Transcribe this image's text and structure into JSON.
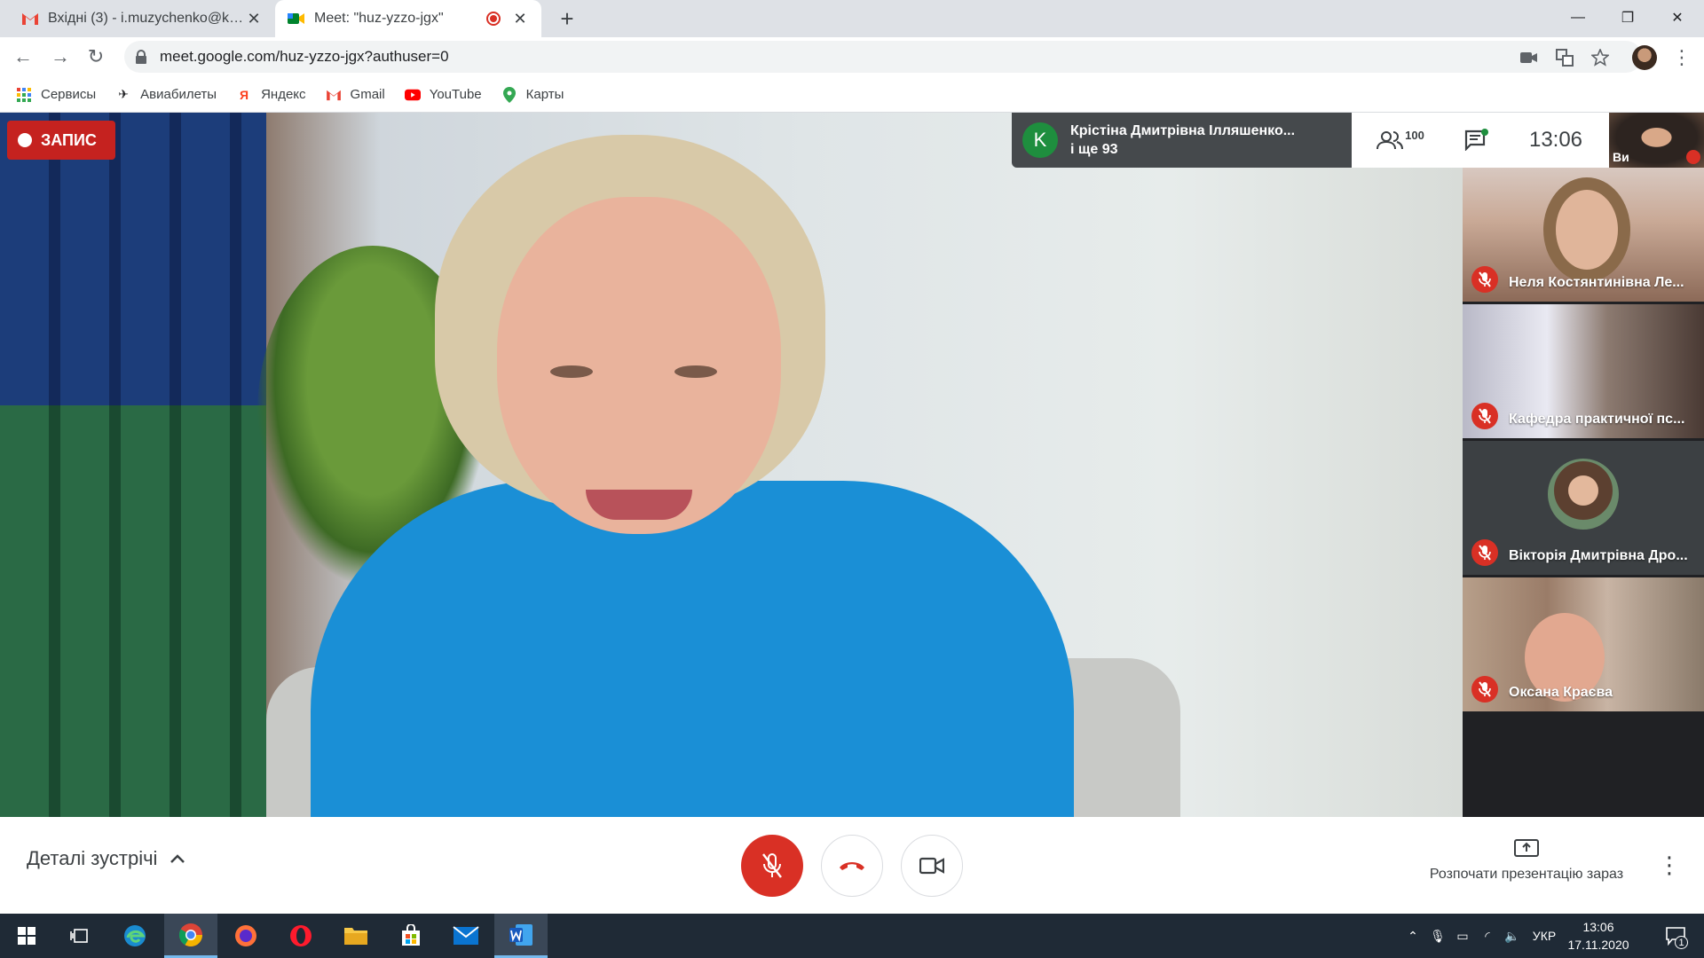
{
  "browser": {
    "tabs": [
      {
        "title": "Вхідні (3) - i.muzychenko@kubg",
        "icon": "gmail-icon"
      },
      {
        "title": "Meet: \"huz-yzzo-jgx\"",
        "icon": "meet-icon"
      }
    ],
    "url": "meet.google.com/huz-yzzo-jgx?authuser=0",
    "bookmarks": [
      {
        "label": "Сервисы",
        "icon": "apps-grid-icon"
      },
      {
        "label": "Авиабилеты",
        "icon": "airplane-icon"
      },
      {
        "label": "Яндекс",
        "icon": "yandex-icon"
      },
      {
        "label": "Gmail",
        "icon": "gmail-icon"
      },
      {
        "label": "YouTube",
        "icon": "youtube-icon"
      },
      {
        "label": "Карты",
        "icon": "maps-pin-icon"
      }
    ]
  },
  "meet": {
    "recording_label": "ЗАПИС",
    "presenter": {
      "initial": "K",
      "name": "Крістіна Дмитрівна Ілляшенко...",
      "others": "і ще 93"
    },
    "participants_count": "100",
    "time": "13:06",
    "self_label": "Ви",
    "participants": [
      {
        "name": "Неля Костянтинівна Ле..."
      },
      {
        "name": "Кафедра практичної пс..."
      },
      {
        "name": "Вікторія Дмитрівна Дро..."
      },
      {
        "name": "Оксана Краєва"
      }
    ],
    "details_label": "Деталі зустрічі",
    "present_label": "Розпочати презентацію зараз",
    "colors": {
      "mic_off": "#d93025",
      "end_call": "#d93025",
      "presenter_avatar": "#1e8e3e"
    }
  },
  "taskbar": {
    "apps": [
      "windows-start-icon",
      "task-view-icon",
      "edge-icon",
      "chrome-icon",
      "firefox-icon",
      "opera-icon",
      "file-explorer-icon",
      "store-icon",
      "mail-icon",
      "word-icon"
    ],
    "language": "УКР",
    "time": "13:06",
    "date": "17.11.2020",
    "notifications": "1"
  }
}
